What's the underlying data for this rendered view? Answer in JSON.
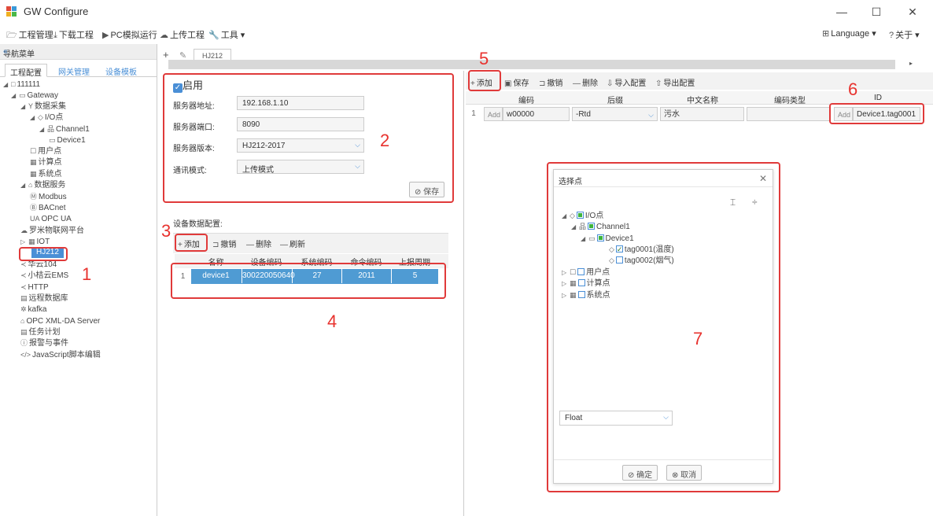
{
  "window": {
    "title": "GW Configure",
    "minimize": "—",
    "maximize": "☐",
    "close": "✕"
  },
  "menubar": {
    "items": [
      {
        "icon": "folder-icon",
        "glyph": "🗁",
        "label": "工程管理"
      },
      {
        "icon": "download-icon",
        "glyph": "⤓",
        "label": "下载工程"
      },
      {
        "icon": "play-icon",
        "glyph": "▶",
        "label": "PC模拟运行"
      },
      {
        "icon": "upload-cloud-icon",
        "glyph": "☁",
        "label": "上传工程"
      },
      {
        "icon": "wrench-icon",
        "glyph": "🔧",
        "label": "工具 ▾"
      }
    ],
    "language": "Language ▾",
    "about": "关于 ▾"
  },
  "nav": {
    "title": "导航菜单",
    "collapse": "«",
    "tabs": [
      "工程配置",
      "网关管理",
      "设备模板"
    ],
    "tree": [
      {
        "toggle": "◢",
        "icon": "□",
        "label": "111111"
      },
      {
        "toggle": "◢",
        "icon": "▭",
        "label": "Gateway"
      },
      {
        "toggle": "◢",
        "icon": "Y",
        "label": "数据采集"
      },
      {
        "toggle": "◢",
        "icon": "◇",
        "label": "I/O点"
      },
      {
        "toggle": "◢",
        "icon": "品",
        "label": "Channel1"
      },
      {
        "toggle": "",
        "icon": "▭",
        "label": "Device1"
      },
      {
        "toggle": "",
        "icon": "☐",
        "label": "用户点"
      },
      {
        "toggle": "",
        "icon": "▦",
        "label": "计算点"
      },
      {
        "toggle": "",
        "icon": "▦",
        "label": "系统点"
      },
      {
        "toggle": "◢",
        "icon": "⌂",
        "label": "数据服务"
      },
      {
        "toggle": "",
        "icon": "Ⓜ",
        "label": "Modbus"
      },
      {
        "toggle": "",
        "icon": "Ⓑ",
        "label": "BACnet"
      },
      {
        "toggle": "",
        "icon": "UA",
        "label": "OPC UA"
      },
      {
        "toggle": "",
        "icon": "☁",
        "label": "罗米物联网平台"
      },
      {
        "toggle": "▷",
        "icon": "▦",
        "label": "IOT"
      },
      {
        "toggle": "",
        "icon": "",
        "label": "HJ212"
      },
      {
        "toggle": "",
        "icon": "≺",
        "label": "华云104"
      },
      {
        "toggle": "",
        "icon": "≺",
        "label": "小桔云EMS"
      },
      {
        "toggle": "",
        "icon": "≺",
        "label": "HTTP"
      },
      {
        "toggle": "",
        "icon": "▤",
        "label": "远程数据库"
      },
      {
        "toggle": "",
        "icon": "✲",
        "label": "kafka"
      },
      {
        "toggle": "",
        "icon": "⌂",
        "label": "OPC XML-DA Server"
      },
      {
        "toggle": "",
        "icon": "▤",
        "label": "任务计划"
      },
      {
        "toggle": "",
        "icon": "ⓘ",
        "label": "报警与事件"
      },
      {
        "toggle": "",
        "icon": "</>",
        "label": "JavaScript脚本编辑"
      }
    ]
  },
  "tabs": {
    "add": "+",
    "edit": "✎",
    "current": "HJ212"
  },
  "server": {
    "enabled_label": "启用",
    "address_label": "服务器地址:",
    "address": "192.168.1.10",
    "port_label": "服务器端口:",
    "port": "8090",
    "version_label": "服务器版本:",
    "version": "HJ212-2017",
    "mode_label": "通讯模式:",
    "mode": "上传模式",
    "save": "保存"
  },
  "device_config": {
    "title": "设备数据配置:",
    "toolbar": {
      "add": "添加",
      "undo": "撤销",
      "delete": "删除",
      "refresh": "刷新"
    },
    "headers": [
      "名称",
      "设备编码",
      "系统编码",
      "命令编码",
      "上报周期"
    ],
    "rows": [
      {
        "index": "1",
        "name": "device1",
        "code": "300220050640",
        "sys": "27",
        "cmd": "2011",
        "period": "5"
      }
    ]
  },
  "point_config": {
    "toolbar": {
      "add": "添加",
      "save": "保存",
      "undo": "撤销",
      "delete": "删除",
      "import": "导入配置",
      "export": "导出配置"
    },
    "headers": [
      "编码",
      "后缀",
      "中文名称",
      "编码类型",
      "ID"
    ],
    "rows": [
      {
        "index": "1",
        "add": "Add",
        "code": "w00000",
        "suffix": "-Rtd",
        "name": "污水",
        "type": "",
        "id_add": "Add",
        "id": "Device1.tag0001"
      }
    ]
  },
  "dialog": {
    "title": "选择点",
    "close": "✕",
    "tool1": "⌶",
    "tool2": "÷",
    "tree": [
      {
        "label": "I/O点"
      },
      {
        "label": "Channel1"
      },
      {
        "label": "Device1"
      },
      {
        "label": "tag0001(温度)"
      },
      {
        "label": "tag0002(烟气)"
      },
      {
        "label": "用户点"
      },
      {
        "label": "计算点"
      },
      {
        "label": "系统点"
      }
    ],
    "type": "Float",
    "ok": "确定",
    "cancel": "取消"
  },
  "annotations": [
    "1",
    "2",
    "3",
    "4",
    "5",
    "6",
    "7"
  ],
  "colors": {
    "accent": "#4a8fd6",
    "annotation": "#e03a3a",
    "selected_row": "#4f9bd3"
  }
}
